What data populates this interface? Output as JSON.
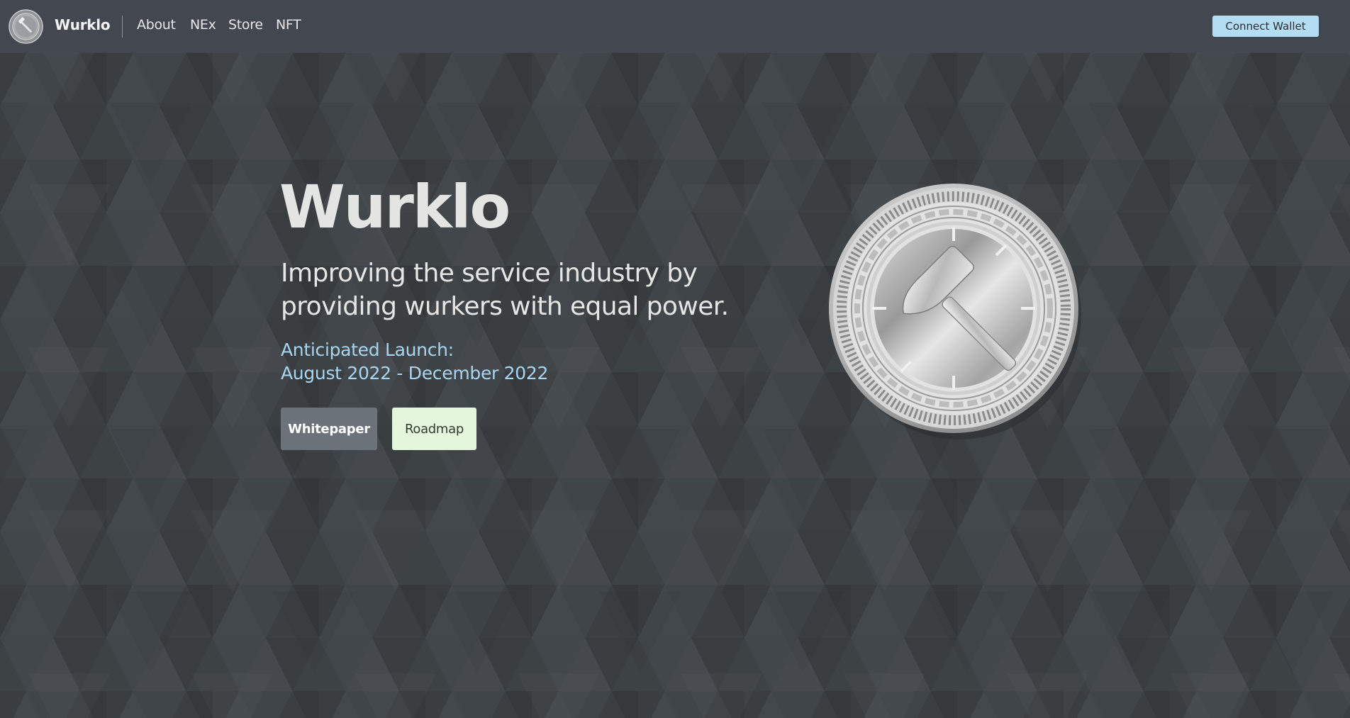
{
  "nav": {
    "brand": "Wurklo",
    "links": [
      "About",
      "NEx",
      "Store",
      "NFT"
    ],
    "connect_wallet": "Connect Wallet"
  },
  "hero": {
    "title": "Wurklo",
    "tagline": "Improving the service industry by providing wurkers with equal power.",
    "launch_label": "Anticipated Launch:",
    "launch_dates": "August 2022 - December 2022",
    "buttons": {
      "whitepaper": "Whitepaper",
      "roadmap": "Roadmap"
    }
  },
  "colors": {
    "background": "#3d4245",
    "navbar": "#434850",
    "accent_blue": "#a8d5f0",
    "connect_button": "#b4ddf3",
    "whitepaper_button": "#6c727a",
    "roadmap_button": "#e4f7dc"
  },
  "icons": {
    "brand_logo": "silver-coin-hammer-logo",
    "hero_image": "silver-coin-hammer-icon"
  }
}
